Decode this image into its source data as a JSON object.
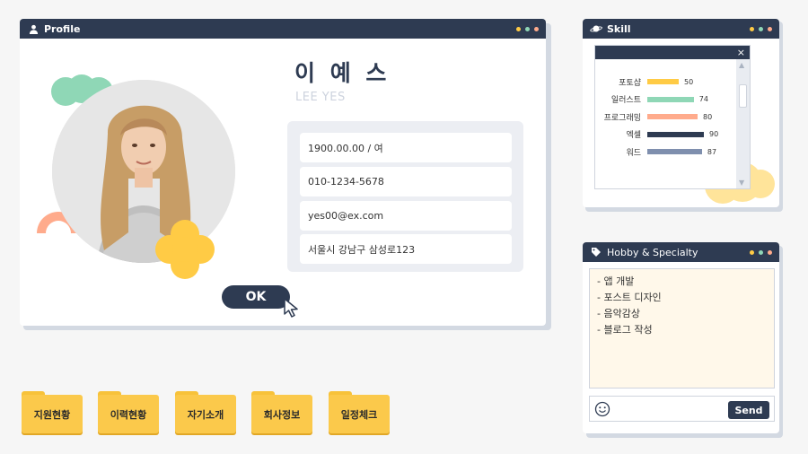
{
  "colors": {
    "navy": "#2e3b52",
    "yellow": "#ffcb45",
    "mint": "#8fd7b6",
    "salmon": "#ffab8c",
    "slate": "#7f8fae",
    "dot_yellow": "#ffcb45",
    "dot_green": "#8fd7b6",
    "dot_salmon": "#ffab8c"
  },
  "profile": {
    "title": "Profile",
    "title_icon": "user-icon",
    "name": "이 예 스",
    "english_name": "LEE YES",
    "birth_gender": "1900.00.00 / 여",
    "phone": "010-1234-5678",
    "email": "yes00@ex.com",
    "address": "서울시 강남구 삼성로123",
    "ok_label": "OK"
  },
  "skill": {
    "title": "Skill",
    "title_icon": "planet-icon",
    "close_label": "×",
    "items": [
      {
        "name": "포토샵",
        "value": 50,
        "color": "#ffcb45"
      },
      {
        "name": "일러스트",
        "value": 74,
        "color": "#8fd7b6"
      },
      {
        "name": "프로그래밍",
        "value": 80,
        "color": "#ffab8c"
      },
      {
        "name": "엑셀",
        "value": 90,
        "color": "#2e3b52"
      },
      {
        "name": "워드",
        "value": 87,
        "color": "#7f8fae"
      }
    ]
  },
  "hobby": {
    "title": "Hobby & Specialty",
    "title_icon": "tags-icon",
    "lines": [
      "- 앱 개발",
      "- 포스트 디자인",
      "- 음악감상",
      "- 블로그 작성"
    ],
    "send_label": "Send"
  },
  "folders": [
    "지원현황",
    "이력현황",
    "자기소개",
    "회사정보",
    "일정체크"
  ]
}
